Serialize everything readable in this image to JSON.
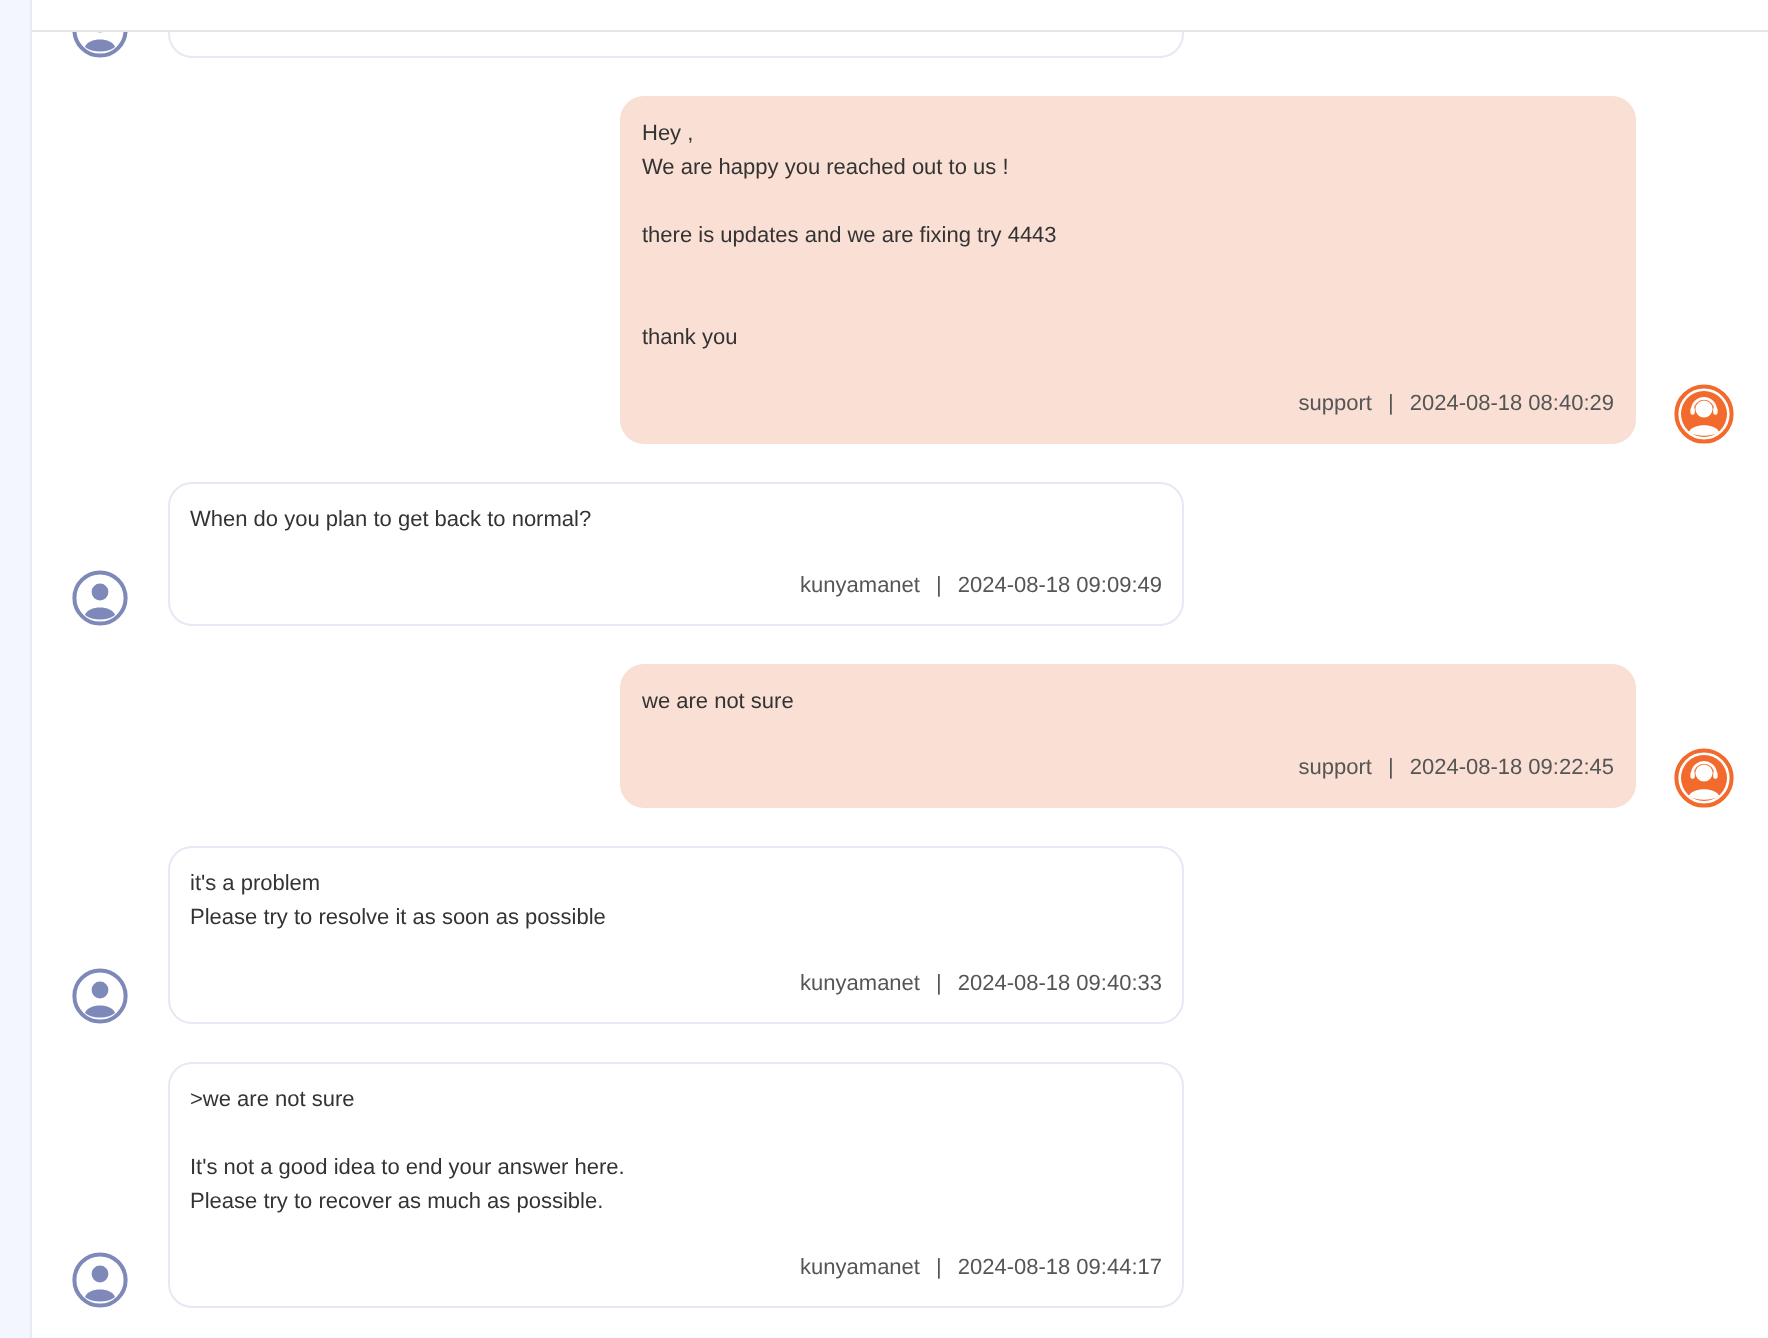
{
  "messages": [
    {
      "kind": "user"
    },
    {
      "kind": "support",
      "text": "Hey ,\nWe are happy you reached out to us !\n\nthere is updates and we are fixing try 4443\n\n\nthank you",
      "author": "support",
      "separator": "|",
      "time": "2024-08-18 08:40:29"
    },
    {
      "kind": "user",
      "text": "When do you plan to get back to normal?",
      "author": "kunyamanet",
      "separator": "|",
      "time": "2024-08-18 09:09:49"
    },
    {
      "kind": "support",
      "text": "we are not sure",
      "author": "support",
      "separator": "|",
      "time": "2024-08-18 09:22:45"
    },
    {
      "kind": "user",
      "text": "it's a problem\nPlease try to resolve it as soon as possible",
      "author": "kunyamanet",
      "separator": "|",
      "time": "2024-08-18 09:40:33"
    },
    {
      "kind": "user",
      "text": ">we are not sure\n\nIt's not a good idea to end your answer here.\nPlease try to recover as much as possible.",
      "author": "kunyamanet",
      "separator": "|",
      "time": "2024-08-18 09:44:17"
    }
  ]
}
